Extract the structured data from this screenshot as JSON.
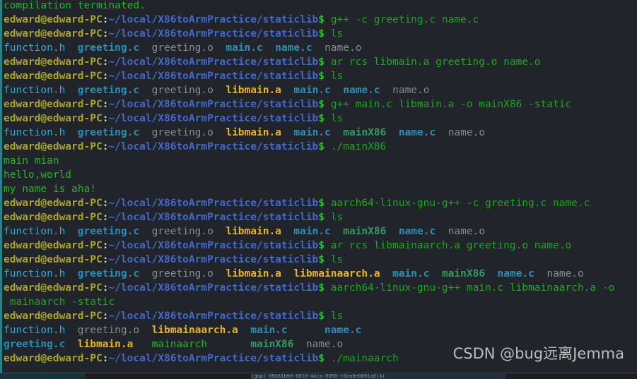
{
  "terminal": {
    "host_prompt": {
      "user": "edward@edward-PC",
      "colon": ":",
      "path": "~/local/X86toArmPractice/staticlib",
      "dollar": "$"
    },
    "lines": [
      {
        "id": "caret-error",
        "type": "error-caret",
        "text": "            ^^^^^^^^^^"
      },
      {
        "id": "compilation-terminated",
        "type": "output",
        "text": "compilation terminated."
      },
      {
        "id": "cmd-gpp-compile",
        "type": "prompt",
        "command": " g++ -c greeting.c name.c"
      },
      {
        "id": "cmd-ls-1",
        "type": "prompt",
        "command": " ls"
      },
      {
        "id": "ls-out-1",
        "type": "ls",
        "cells": [
          {
            "text": "function.h",
            "kind": "hdr"
          },
          {
            "text": "  ",
            "kind": "gap"
          },
          {
            "text": "greeting.c",
            "kind": "src"
          },
          {
            "text": "  ",
            "kind": "gap"
          },
          {
            "text": "greeting.o",
            "kind": "obj"
          },
          {
            "text": "  ",
            "kind": "gap"
          },
          {
            "text": "main.c",
            "kind": "src"
          },
          {
            "text": "  ",
            "kind": "gap"
          },
          {
            "text": "name.c",
            "kind": "src"
          },
          {
            "text": "  ",
            "kind": "gap"
          },
          {
            "text": "name.o",
            "kind": "obj"
          }
        ]
      },
      {
        "id": "cmd-ar-libmain",
        "type": "prompt",
        "command": " ar rcs libmain.a greeting.o name.o"
      },
      {
        "id": "cmd-ls-2",
        "type": "prompt",
        "command": " ls"
      },
      {
        "id": "ls-out-2",
        "type": "ls",
        "cells": [
          {
            "text": "function.h",
            "kind": "hdr"
          },
          {
            "text": "  ",
            "kind": "gap"
          },
          {
            "text": "greeting.c",
            "kind": "src"
          },
          {
            "text": "  ",
            "kind": "gap"
          },
          {
            "text": "greeting.o",
            "kind": "obj"
          },
          {
            "text": "  ",
            "kind": "gap"
          },
          {
            "text": "libmain.a",
            "kind": "arch"
          },
          {
            "text": "  ",
            "kind": "gap"
          },
          {
            "text": "main.c",
            "kind": "src"
          },
          {
            "text": "  ",
            "kind": "gap"
          },
          {
            "text": "name.c",
            "kind": "src"
          },
          {
            "text": "  ",
            "kind": "gap"
          },
          {
            "text": "name.o",
            "kind": "obj"
          }
        ]
      },
      {
        "id": "cmd-gpp-link-x86",
        "type": "prompt",
        "command": " g++ main.c libmain.a -o mainX86 -static"
      },
      {
        "id": "cmd-ls-3",
        "type": "prompt",
        "command": " ls"
      },
      {
        "id": "ls-out-3",
        "type": "ls",
        "cells": [
          {
            "text": "function.h",
            "kind": "hdr"
          },
          {
            "text": "  ",
            "kind": "gap"
          },
          {
            "text": "greeting.c",
            "kind": "src"
          },
          {
            "text": "  ",
            "kind": "gap"
          },
          {
            "text": "greeting.o",
            "kind": "obj"
          },
          {
            "text": "  ",
            "kind": "gap"
          },
          {
            "text": "libmain.a",
            "kind": "arch"
          },
          {
            "text": "  ",
            "kind": "gap"
          },
          {
            "text": "main.c",
            "kind": "src"
          },
          {
            "text": "  ",
            "kind": "gap"
          },
          {
            "text": "mainX86",
            "kind": "exe"
          },
          {
            "text": "  ",
            "kind": "gap"
          },
          {
            "text": "name.c",
            "kind": "src"
          },
          {
            "text": "  ",
            "kind": "gap"
          },
          {
            "text": "name.o",
            "kind": "obj"
          }
        ]
      },
      {
        "id": "cmd-run-mainx86",
        "type": "prompt",
        "command": " ./mainX86"
      },
      {
        "id": "out-main-mian",
        "type": "output",
        "text": "main mian"
      },
      {
        "id": "out-hello-world",
        "type": "output",
        "text": "hello,world"
      },
      {
        "id": "out-my-name",
        "type": "output",
        "text": "my name is aha!"
      },
      {
        "id": "cmd-aarch64-compile",
        "type": "prompt",
        "command": " aarch64-linux-gnu-g++ -c greeting.c name.c"
      },
      {
        "id": "cmd-ls-4",
        "type": "prompt",
        "command": " ls"
      },
      {
        "id": "ls-out-4",
        "type": "ls",
        "cells": [
          {
            "text": "function.h",
            "kind": "hdr"
          },
          {
            "text": "  ",
            "kind": "gap"
          },
          {
            "text": "greeting.c",
            "kind": "src"
          },
          {
            "text": "  ",
            "kind": "gap"
          },
          {
            "text": "greeting.o",
            "kind": "obj"
          },
          {
            "text": "  ",
            "kind": "gap"
          },
          {
            "text": "libmain.a",
            "kind": "arch"
          },
          {
            "text": "  ",
            "kind": "gap"
          },
          {
            "text": "main.c",
            "kind": "src"
          },
          {
            "text": "  ",
            "kind": "gap"
          },
          {
            "text": "mainX86",
            "kind": "exe"
          },
          {
            "text": "  ",
            "kind": "gap"
          },
          {
            "text": "name.c",
            "kind": "src"
          },
          {
            "text": "  ",
            "kind": "gap"
          },
          {
            "text": "name.o",
            "kind": "obj"
          }
        ]
      },
      {
        "id": "cmd-ar-libmainaarch",
        "type": "prompt",
        "command": " ar rcs libmainaarch.a greeting.o name.o"
      },
      {
        "id": "cmd-ls-5",
        "type": "prompt",
        "command": " ls"
      },
      {
        "id": "ls-out-5",
        "type": "ls",
        "cells": [
          {
            "text": "function.h",
            "kind": "hdr"
          },
          {
            "text": "  ",
            "kind": "gap"
          },
          {
            "text": "greeting.c",
            "kind": "src"
          },
          {
            "text": "  ",
            "kind": "gap"
          },
          {
            "text": "greeting.o",
            "kind": "obj"
          },
          {
            "text": "  ",
            "kind": "gap"
          },
          {
            "text": "libmain.a",
            "kind": "arch"
          },
          {
            "text": "  ",
            "kind": "gap"
          },
          {
            "text": "libmainaarch.a",
            "kind": "arch"
          },
          {
            "text": "  ",
            "kind": "gap"
          },
          {
            "text": "main.c",
            "kind": "src"
          },
          {
            "text": "  ",
            "kind": "gap"
          },
          {
            "text": "mainX86",
            "kind": "exe"
          },
          {
            "text": "  ",
            "kind": "gap"
          },
          {
            "text": "name.c",
            "kind": "src"
          },
          {
            "text": "  ",
            "kind": "gap"
          },
          {
            "text": "name.o",
            "kind": "obj"
          }
        ]
      },
      {
        "id": "cmd-aarch64-link",
        "type": "prompt",
        "command": " aarch64-linux-gnu-g++ main.c libmainaarch.a -o"
      },
      {
        "id": "cmd-aarch64-link-wrap",
        "type": "command-continuation",
        "text": " mainaarch -static"
      },
      {
        "id": "cmd-ls-6",
        "type": "prompt",
        "command": " ls"
      },
      {
        "id": "ls-out-6-row1",
        "type": "ls",
        "cells": [
          {
            "text": "function.h",
            "kind": "hdr"
          },
          {
            "text": "  ",
            "kind": "gap"
          },
          {
            "text": "greeting.o",
            "kind": "obj"
          },
          {
            "text": "  ",
            "kind": "gap"
          },
          {
            "text": "libmainaarch.a",
            "kind": "arch"
          },
          {
            "text": "  ",
            "kind": "gap"
          },
          {
            "text": "main.c",
            "kind": "src"
          },
          {
            "text": "      ",
            "kind": "gap"
          },
          {
            "text": "name.c",
            "kind": "src"
          }
        ]
      },
      {
        "id": "ls-out-6-row2",
        "type": "ls",
        "cells": [
          {
            "text": "greeting.c",
            "kind": "src"
          },
          {
            "text": "  ",
            "kind": "gap"
          },
          {
            "text": "libmain.a",
            "kind": "arch"
          },
          {
            "text": "   ",
            "kind": "gap"
          },
          {
            "text": "mainaarch",
            "kind": "plain"
          },
          {
            "text": "       ",
            "kind": "gap"
          },
          {
            "text": "mainX86",
            "kind": "exe"
          },
          {
            "text": "  ",
            "kind": "gap"
          },
          {
            "text": "name.o",
            "kind": "obj"
          }
        ]
      },
      {
        "id": "cmd-run-mainaarch",
        "type": "prompt",
        "command": " ./mainaarch"
      }
    ]
  },
  "watermark": {
    "text": "CSDN @bug远离Jemma"
  },
  "taskbar": {
    "item_label": "[gbp] 00b81b00-0010-4aca-0000-f0aa0e0001a0(A)"
  },
  "colors": {
    "background": "#21242b",
    "prompt_user": "#a8a42b",
    "prompt_path": "#4169c9",
    "prompt_dollar": "#2bbf2b",
    "command": "#19a819",
    "output": "#22b522",
    "error": "#cc3333",
    "source_file": "#2a8fb5",
    "header_file": "#3aa6cf",
    "object_file": "#8a8a8a",
    "archive_file": "#e8b51d",
    "executable_file": "#2f9c5f",
    "left_border": "#2d7d82"
  }
}
